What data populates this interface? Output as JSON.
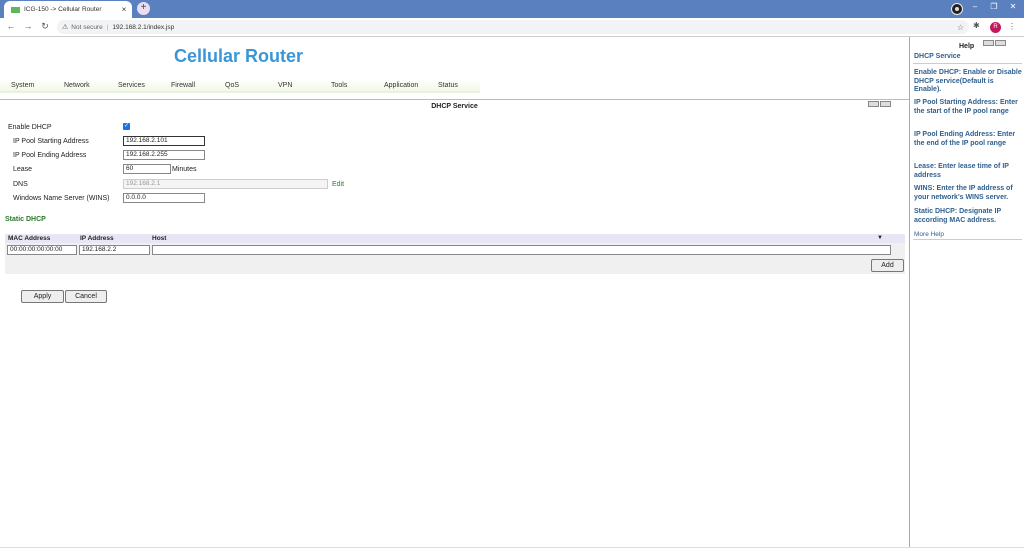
{
  "browser": {
    "tab_title": "ICG-150 -> Cellular Router",
    "not_secure": "Not secure",
    "url": "192.168.2.1/index.jsp",
    "avatar_letter": "R"
  },
  "header": {
    "brand": "Cellular Router"
  },
  "menu": [
    "System",
    "Network",
    "Services",
    "Firewall",
    "QoS",
    "VPN",
    "Tools",
    "Application",
    "Status"
  ],
  "section_title": "DHCP Service",
  "form": {
    "enable_label": "Enable DHCP",
    "enabled": true,
    "pool_start_label": "IP Pool Starting Address",
    "pool_start_value": "192.168.2.101",
    "pool_end_label": "IP Pool Ending Address",
    "pool_end_value": "192.168.2.255",
    "lease_label": "Lease",
    "lease_value": "60",
    "lease_unit": "Minutes",
    "dns_label": "DNS",
    "dns_value": "192.168.2.1",
    "dns_edit": "Edit",
    "wins_label": "Windows Name Server (WINS)",
    "wins_value": "0.0.0.0"
  },
  "static_dhcp": {
    "title": "Static DHCP",
    "headers": [
      "MAC Address",
      "IP Address",
      "Host"
    ],
    "row": {
      "mac": "00:00:00:00:00:00",
      "ip": "192.168.2.2",
      "host": ""
    },
    "add_label": "Add"
  },
  "actions": {
    "apply": "Apply",
    "cancel": "Cancel"
  },
  "help": {
    "title": "Help",
    "subtitle": "DHCP Service",
    "items": [
      "Enable DHCP: Enable or Disable DHCP service(Default is Enable).",
      "IP Pool Starting Address: Enter the start of the IP pool range",
      "IP Pool Ending Address: Enter the end of the IP pool range",
      "Lease: Enter lease time of IP address",
      "WINS: Enter the IP address of your network's WINS server.",
      "Static DHCP: Designate IP according MAC address."
    ],
    "more": "More Help"
  }
}
